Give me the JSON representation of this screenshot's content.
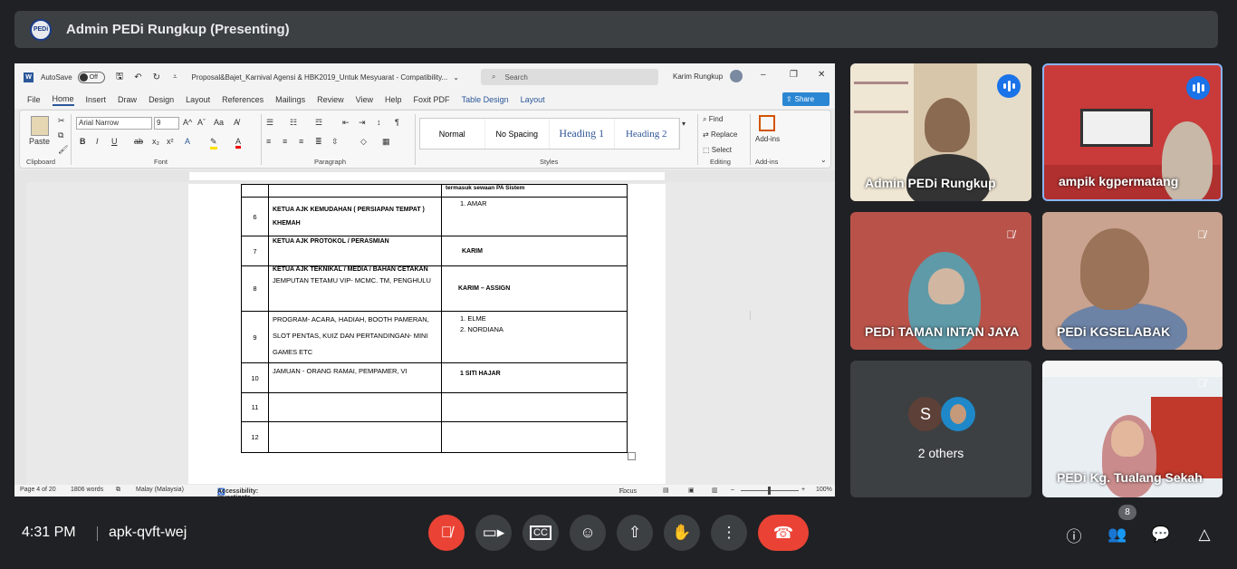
{
  "meeting": {
    "presenter_title": "Admin PEDi Rungkup (Presenting)",
    "logo_text": "PEDi",
    "time": "4:31 PM",
    "code": "apk-qvft-wej",
    "participant_count": "8"
  },
  "word": {
    "autosave": "AutoSave",
    "autosave_state": "Off",
    "doc_title": "Proposal&Bajet_Karnival Agensi & HBK2019_Untuk Mesyuarat  -  Compatibility...",
    "search_placeholder": "Search",
    "user": "Karim Rungkup",
    "share": "Share",
    "menus": [
      "File",
      "Home",
      "Insert",
      "Draw",
      "Design",
      "Layout",
      "References",
      "Mailings",
      "Review",
      "View",
      "Help",
      "Foxit PDF",
      "Table Design",
      "Layout"
    ],
    "font": "Arial Narrow",
    "font_size": "9",
    "clipboard_paste": "Paste",
    "groups": [
      "Clipboard",
      "Font",
      "Paragraph",
      "Styles",
      "Editing",
      "Add-ins"
    ],
    "styles": [
      "Normal",
      "No Spacing",
      "Heading 1",
      "Heading 2"
    ],
    "editing": [
      "Find",
      "Replace",
      "Select"
    ],
    "addins": "Add-ins",
    "status": {
      "page": "Page 4 of 20",
      "words": "1806 words",
      "lang": "Malay (Malaysia)",
      "access": "Accessibility: Investigate",
      "focus": "Focus",
      "zoom": "100%"
    }
  },
  "doc_table": {
    "top_note": "termasuk sewaan PA Sistem",
    "rows": [
      {
        "no": "6",
        "desc_bold": "KETUA AJK KEMUDAHAN ( PERSIAPAN TEMPAT ) KHEMAH",
        "desc": "",
        "pic": "1.    AMAR"
      },
      {
        "no": "7",
        "desc_bold": "KETUA AJK PROTOKOL / PERASMIAN",
        "desc": "",
        "pic": "KARIM"
      },
      {
        "no": "8",
        "desc_bold": "KETUA AJK TEKNIKAL / MEDIA / BAHAN CETAKAN",
        "desc": "JEMPUTAN TETAMU VIP- MCMC. TM, PENGHULU",
        "pic": "KARIM – ASSIGN"
      },
      {
        "no": "9",
        "desc_bold": "",
        "desc": "PROGRAM- ACARA, HADIAH, BOOTH PAMERAN, SLOT PENTAS, KUIZ DAN PERTANDINGAN- MINI GAMES ETC",
        "pic": "1.    ELME\n2.    NORDIANA"
      },
      {
        "no": "10",
        "desc_bold": "",
        "desc": "JAMUAN - ORANG RAMAI, PEMPAMER, VI",
        "pic": "1      SITI HAJAR"
      },
      {
        "no": "11",
        "desc_bold": "",
        "desc": "",
        "pic": ""
      },
      {
        "no": "12",
        "desc_bold": "",
        "desc": "",
        "pic": ""
      }
    ]
  },
  "participants": [
    {
      "name": "Admin PEDi Rungkup"
    },
    {
      "name": "ampik kgpermatang"
    },
    {
      "name": "PEDi TAMAN INTAN JAYA"
    },
    {
      "name": "PEDi KGSELABAK"
    },
    {
      "name": "2 others",
      "initial": "S"
    },
    {
      "name": "PEDi Kg. Tualang Sekah"
    }
  ]
}
